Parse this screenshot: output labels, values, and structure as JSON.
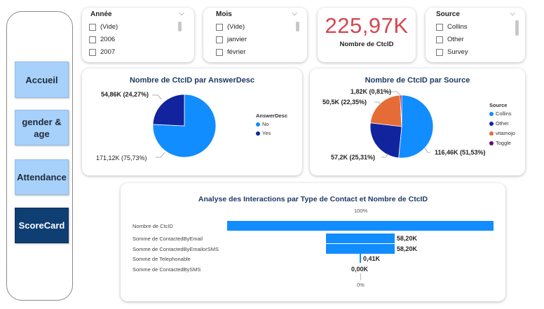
{
  "nav": {
    "accueil": "Accueil",
    "gender_age": "gender & age",
    "attendance": "Attendance",
    "scorecard": "ScoreCard"
  },
  "slicers": {
    "annee": {
      "title": "Année",
      "items": [
        "(Vide)",
        "2006",
        "2007"
      ]
    },
    "mois": {
      "title": "Mois",
      "items": [
        "(Vide)",
        "janvier",
        "février"
      ]
    },
    "source": {
      "title": "Source",
      "items": [
        "Collins",
        "Other",
        "Survey"
      ]
    }
  },
  "kpi": {
    "value": "225,97K",
    "label": "Nombre de CtcID"
  },
  "pie1": {
    "title": "Nombre de CtcID par AnswerDesc",
    "legend_title": "AnswerDesc",
    "chart_data": {
      "type": "pie",
      "title": "Nombre de CtcID par AnswerDesc",
      "categories": [
        "No",
        "Yes"
      ],
      "values": [
        171.12,
        54.86
      ],
      "percent": [
        75.73,
        24.27
      ],
      "colors": [
        "#118dff",
        "#12239e"
      ],
      "labels": [
        "171,12K (75,73%)",
        "54,86K (24,27%)"
      ],
      "legend_position": "right"
    }
  },
  "pie2": {
    "title": "Nombre de CtcID par Source",
    "legend_title": "Source",
    "chart_data": {
      "type": "pie",
      "title": "Nombre de CtcID par Source",
      "categories": [
        "Collins",
        "Other",
        "vitamojo",
        "Toggle"
      ],
      "values": [
        116.46,
        57.2,
        50.5,
        1.82
      ],
      "percent": [
        51.53,
        25.31,
        22.35,
        0.81
      ],
      "colors": [
        "#118dff",
        "#12239e",
        "#e66c37",
        "#6b007b"
      ],
      "labels": [
        "116,46K (51,53%)",
        "57,2K (25,31%)",
        "50,5K (22,35%)",
        "1,82K (0,81%)"
      ],
      "legend_position": "right"
    }
  },
  "funnel": {
    "title": "Analyse des Interactions par Type de Contact et Nombre de CtcID",
    "top_pct": "100%",
    "bottom_pct": "0%",
    "chart_data": {
      "type": "bar",
      "title": "Analyse des Interactions par Type de Contact et Nombre de CtcID",
      "categories": [
        "Nombre de CtcID",
        "Somme de ContactedByEmail",
        "Somme de ContactedByEmailorSMS",
        "Somme de Telephonable",
        "Somme de ContactedBySMS"
      ],
      "values": [
        225.97,
        58.2,
        58.2,
        0.41,
        0.0
      ],
      "value_labels": [
        "",
        "58,20K",
        "58,20K",
        "0,41K",
        "0,00K"
      ],
      "color": "#118dff"
    }
  }
}
